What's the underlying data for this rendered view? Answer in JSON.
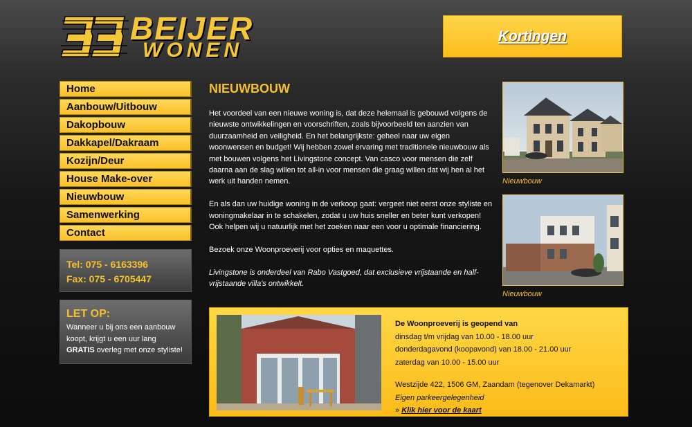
{
  "logo": {
    "top": "BEIJER",
    "bottom": "WONEN"
  },
  "promo": {
    "label": "Kortingen"
  },
  "nav": {
    "items": [
      {
        "label": "Home"
      },
      {
        "label": "Aanbouw/Uitbouw"
      },
      {
        "label": "Dakopbouw"
      },
      {
        "label": "Dakkapel/Dakraam"
      },
      {
        "label": "Kozijn/Deur"
      },
      {
        "label": "House Make-over"
      },
      {
        "label": "Nieuwbouw"
      },
      {
        "label": "Samenwerking"
      },
      {
        "label": "Contact"
      }
    ]
  },
  "contact": {
    "tel": "Tel:  075 - 6163396",
    "fax": "Fax: 075 - 6705447"
  },
  "notice": {
    "title": "LET OP:",
    "text_before": "Wanneer u bij ons een aanbouw koopt, krijgt u een uur lang ",
    "text_bold": "GRATIS",
    "text_after": " overleg met onze styliste!"
  },
  "main": {
    "title": "NIEUWBOUW",
    "p1": "Het voordeel van een nieuwe woning is, dat deze helemaal is gebouwd volgens de nieuwste ontwikkelingen en voorschriften, zoals bijvoorbeeld ten aanzien van duurzaamheid en veiligheid. En het belangrijkste: geheel naar uw eigen woonwensen en budget! Wij hebben zowel ervaring met traditionele nieuwbouw als met bouwen volgens het Livingstone concept. Van casco voor mensen die zelf daarna aan de slag willen tot all-in voor mensen die graag willen dat wij hen al het werk uit handen nemen.",
    "p2": "En als dan uw huidige woning in de verkoop gaat: vergeet niet eerst onze styliste en woningmakelaar in te schakelen, zodat u uw huis sneller en beter kunt verkopen! Ook helpen wij u natuurlijk met het zoeken naar een voor u optimale financiering.",
    "p3": "Bezoek onze Woonproeverij voor opties en maquettes.",
    "p4": "Livingstone is onderdeel van Rabo Vastgoed, dat exclusieve vrijstaande en half-vrijstaande villa's ontwikkelt."
  },
  "photos": {
    "caption1": "Nieuwbouw",
    "caption2": "Nieuwbouw"
  },
  "panel": {
    "heading": "De Woonproeverij is geopend van",
    "hours1": "dinsdag t/m vrijdag van 10.00 - 18.00 uur",
    "hours2": "donderdagavond (koopavond) van 18.00 - 21.00 uur",
    "hours3": "zaterdag van 10.00 - 15.00 uur",
    "address": "Westzijde 422, 1506 GM, Zaandam (tegenover Dekamarkt)",
    "parking": "Eigen parkeergelegenheid",
    "map_prefix": "» ",
    "map_link": "Klik hier voor de kaart"
  }
}
